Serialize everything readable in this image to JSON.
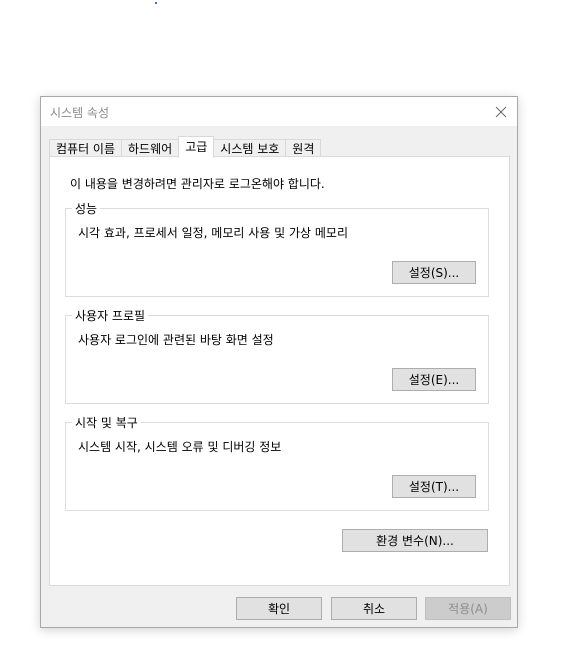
{
  "window": {
    "title": "시스템 속성"
  },
  "tabs": [
    {
      "label": "컴퓨터 이름",
      "active": false
    },
    {
      "label": "하드웨어",
      "active": false
    },
    {
      "label": "고급",
      "active": true
    },
    {
      "label": "시스템 보호",
      "active": false
    },
    {
      "label": "원격",
      "active": false
    }
  ],
  "notice": "이 내용을 변경하려면 관리자로 로그온해야 합니다.",
  "groups": {
    "performance": {
      "label": "성능",
      "description": "시각 효과, 프로세서 일정, 메모리 사용 및 가상 메모리",
      "button": "설정(S)..."
    },
    "user_profiles": {
      "label": "사용자 프로필",
      "description": "사용자 로그인에 관련된 바탕 화면 설정",
      "button": "설정(E)..."
    },
    "startup_recovery": {
      "label": "시작 및 복구",
      "description": "시스템 시작, 시스템 오류 및 디버깅 정보",
      "button": "설정(T)..."
    }
  },
  "env_button": "환경 변수(N)...",
  "footer": {
    "ok": "확인",
    "cancel": "취소",
    "apply": "적용(A)"
  },
  "icons": {
    "close": "close-icon"
  }
}
